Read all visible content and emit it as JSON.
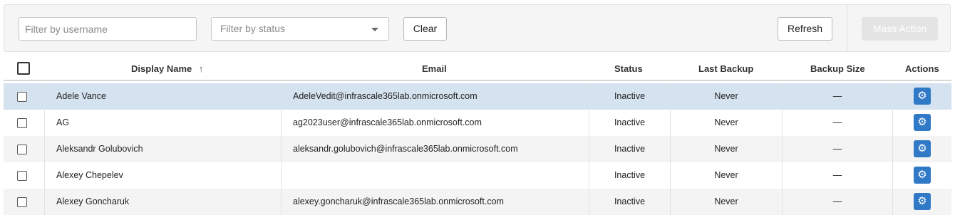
{
  "filters": {
    "username_placeholder": "Filter by username",
    "status_placeholder": "Filter by status",
    "clear_label": "Clear",
    "refresh_label": "Refresh",
    "mass_action_label": "Mass Action"
  },
  "table": {
    "columns": {
      "display_name": "Display Name",
      "email": "Email",
      "status": "Status",
      "last_backup": "Last Backup",
      "backup_size": "Backup Size",
      "actions": "Actions"
    },
    "sort_indicator": "↑",
    "rows": [
      {
        "name": "Adele Vance",
        "email": "AdeleVedit@infrascale365lab.onmicrosoft.com",
        "status": "Inactive",
        "last_backup": "Never",
        "size": "—"
      },
      {
        "name": "AG",
        "email": "ag2023user@infrascale365lab.onmicrosoft.com",
        "status": "Inactive",
        "last_backup": "Never",
        "size": "—"
      },
      {
        "name": "Aleksandr Golubovich",
        "email": "aleksandr.golubovich@infrascale365lab.onmicrosoft.com",
        "status": "Inactive",
        "last_backup": "Never",
        "size": "—"
      },
      {
        "name": "Alexey Chepelev",
        "email": "",
        "status": "Inactive",
        "last_backup": "Never",
        "size": "—"
      },
      {
        "name": "Alexey Goncharuk",
        "email": "alexey.goncharuk@infrascale365lab.onmicrosoft.com",
        "status": "Inactive",
        "last_backup": "Never",
        "size": "—"
      }
    ],
    "action_icon": "gear-icon",
    "accent_color": "#2f79c6",
    "selected_row_color": "#d5e2f0"
  }
}
